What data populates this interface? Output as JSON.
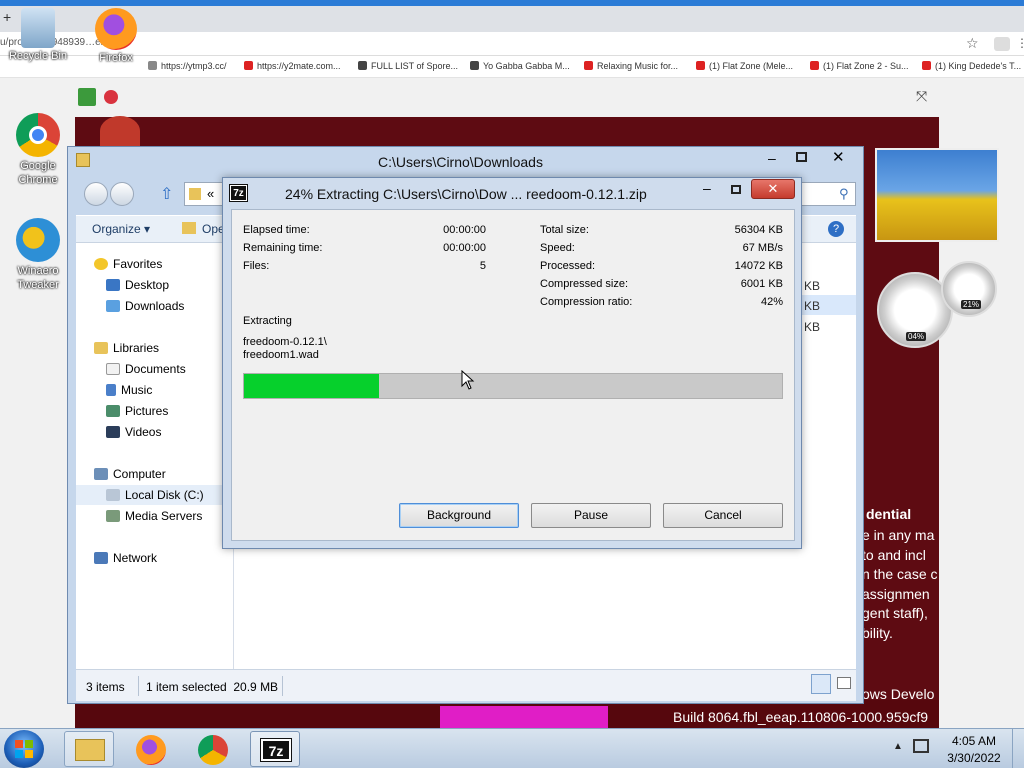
{
  "browser": {
    "url_fragment": "u/proj…653948939…en/",
    "bookmarks": [
      {
        "label": "https://ytmp3.cc/",
        "color": "#888"
      },
      {
        "label": "https://y2mate.com...",
        "color": "#d22"
      },
      {
        "label": "FULL LIST of Spore...",
        "color": "#444"
      },
      {
        "label": "Yo Gabba Gabba M...",
        "color": "#444"
      },
      {
        "label": "Relaxing Music for...",
        "color": "#d22"
      },
      {
        "label": "(1) Flat Zone (Mele...",
        "color": "#d22"
      },
      {
        "label": "(1) Flat Zone 2 - Su...",
        "color": "#d22"
      },
      {
        "label": "(1) King Dedede's T...",
        "color": "#d22"
      }
    ]
  },
  "desktop": {
    "icons": [
      {
        "label": "Recycle Bin"
      },
      {
        "label": "Firefox"
      },
      {
        "label": "Google Chrome"
      },
      {
        "label": "Winaero Tweaker"
      }
    ],
    "gadget_cpu": "04%",
    "gadget_mem": "21%",
    "watermark_heading": "dential",
    "watermark_lines": [
      "e in any ma",
      "to and incl",
      "n the case c",
      "assignmen",
      "gent staff),",
      "bility."
    ],
    "watermark_footer1": "ows Develo",
    "watermark_footer2": "Build 8064.fbl_eeap.110806-1000.959cf9"
  },
  "explorer": {
    "title": "C:\\Users\\Cirno\\Downloads",
    "address_chevron": "«",
    "organize": "Organize",
    "open_partial": "Ope",
    "sizes": [
      "KB",
      "KB",
      "KB"
    ],
    "nav": {
      "favorites": "Favorites",
      "desktop": "Desktop",
      "downloads": "Downloads",
      "libraries": "Libraries",
      "documents": "Documents",
      "music": "Music",
      "pictures": "Pictures",
      "videos": "Videos",
      "computer": "Computer",
      "local_disk": "Local Disk (C:)",
      "media_servers": "Media Servers",
      "network": "Network"
    },
    "status_items": "3 items",
    "status_selected": "1 item selected  20.9 MB"
  },
  "dialog": {
    "app_icon": "7z",
    "title": "24% Extracting C:\\Users\\Cirno\\Dow ... reedoom-0.12.1.zip",
    "elapsed_label": "Elapsed time:",
    "elapsed_value": "00:00:00",
    "remaining_label": "Remaining time:",
    "remaining_value": "00:00:00",
    "files_label": "Files:",
    "files_value": "5",
    "total_label": "Total size:",
    "total_value": "56304 KB",
    "speed_label": "Speed:",
    "speed_value": "67 MB/s",
    "processed_label": "Processed:",
    "processed_value": "14072 KB",
    "compressed_label": "Compressed size:",
    "compressed_value": "6001 KB",
    "ratio_label": "Compression ratio:",
    "ratio_value": "42%",
    "extracting_label": "Extracting",
    "path_line1": "freedoom-0.12.1\\",
    "path_line2": "freedoom1.wad",
    "progress_fraction": 0.25,
    "btn_background": "Background",
    "btn_pause": "Pause",
    "btn_cancel": "Cancel"
  },
  "taskbar": {
    "time": "4:05 AM",
    "date": "3/30/2022",
    "seven_zip_label": "7z"
  }
}
